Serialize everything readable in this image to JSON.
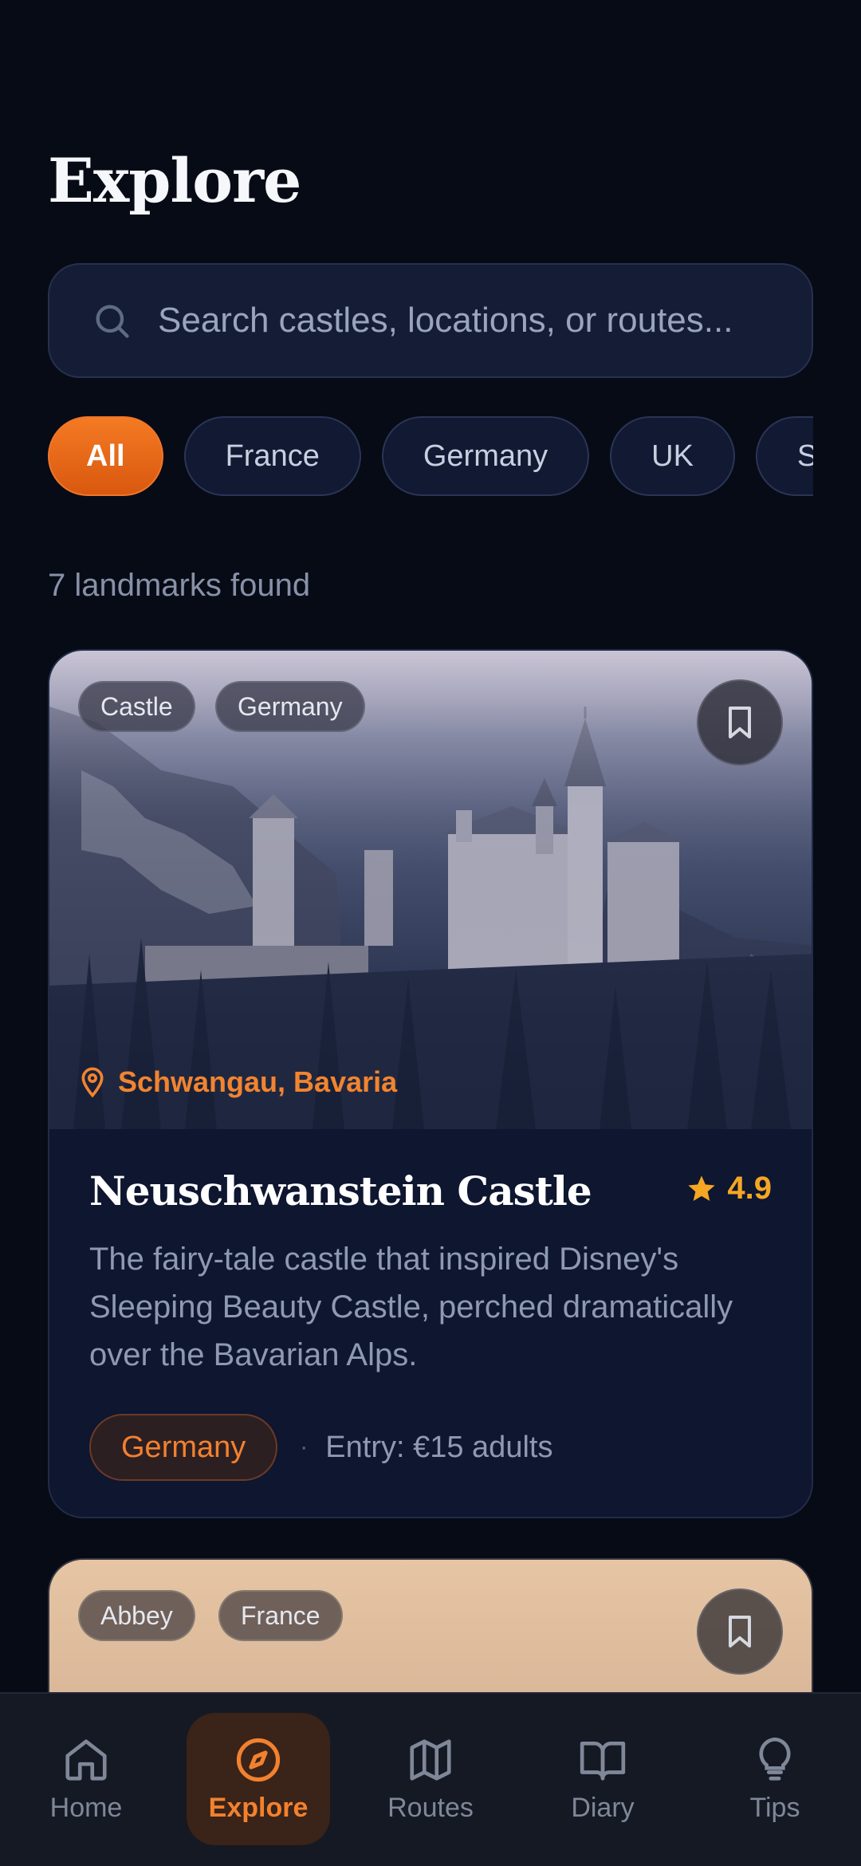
{
  "header": {
    "title": "Explore"
  },
  "search": {
    "placeholder": "Search castles, locations, or routes..."
  },
  "filters": [
    {
      "label": "All",
      "active": true
    },
    {
      "label": "France",
      "active": false
    },
    {
      "label": "Germany",
      "active": false
    },
    {
      "label": "UK",
      "active": false
    },
    {
      "label": "S",
      "active": false
    }
  ],
  "results": {
    "count_text": "7 landmarks found"
  },
  "cards": [
    {
      "tags": [
        "Castle",
        "Germany"
      ],
      "location": "Schwangau, Bavaria",
      "title": "Neuschwanstein Castle",
      "rating": "4.9",
      "description": "The fairy-tale castle that inspired Disney's Sleeping Beauty Castle, perched dramatically over the Bavarian Alps.",
      "country": "Germany",
      "separator": "·",
      "entry": "Entry: €15 adults"
    },
    {
      "tags": [
        "Abbey",
        "France"
      ]
    }
  ],
  "nav": [
    {
      "label": "Home",
      "icon": "home-icon",
      "active": false
    },
    {
      "label": "Explore",
      "icon": "compass-icon",
      "active": true
    },
    {
      "label": "Routes",
      "icon": "map-icon",
      "active": false
    },
    {
      "label": "Diary",
      "icon": "book-icon",
      "active": false
    },
    {
      "label": "Tips",
      "icon": "lightbulb-icon",
      "active": false
    }
  ],
  "colors": {
    "accent": "#f2812f",
    "background": "#070b16",
    "card": "#0e1630",
    "star": "#f5a623"
  }
}
